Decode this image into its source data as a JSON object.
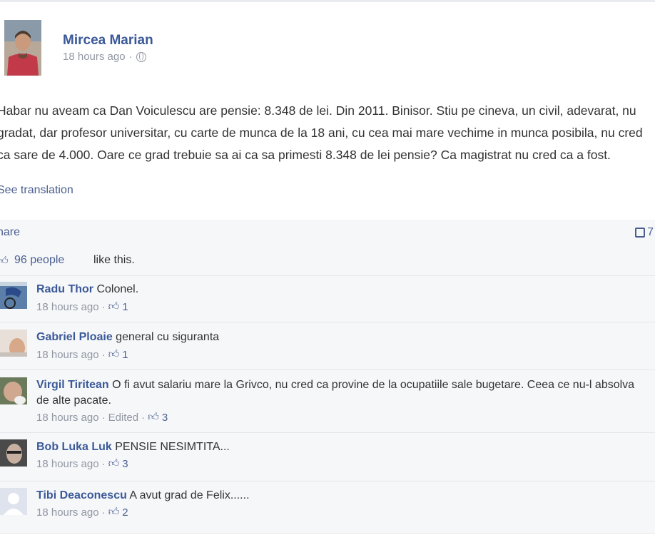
{
  "post": {
    "author": "Mircea Marian",
    "time": "18 hours ago",
    "text": "Habar nu aveam ca Dan Voiculescu are pensie: 8.348 de lei. Din 2011. Binisor. Stiu pe cineva, un civil, adevarat, nu gradat, dar profesor universitar, cu carte de munca de la 18 ani, cu cea mai mare vechime in munca posibila, nu cred ca sare de 4.000. Oare ce grad trebuie sa ai ca sa primesti 8.348 de lei pensie? Ca magistrat nu cred ca a fost.",
    "see_translation": "See translation"
  },
  "actions": {
    "share": "hare",
    "comment_count": "7"
  },
  "likes": {
    "count_link": "96 people",
    "rest": "like this."
  },
  "comments": [
    {
      "author": "Radu Thor",
      "text": "Colonel.",
      "time": "18 hours ago",
      "edited": "",
      "likes": "1"
    },
    {
      "author": "Gabriel Ploaie",
      "text": "general cu siguranta",
      "time": "18 hours ago",
      "edited": "",
      "likes": "1"
    },
    {
      "author": "Virgil Tiritean",
      "text": "O fi avut salariu mare la Grivco, nu cred ca provine de la ocupatiile sale bugetare. Ceea ce nu-l absolva de alte pacate.",
      "time": "18 hours ago",
      "edited": "Edited",
      "likes": "3"
    },
    {
      "author": "Bob Luka Luk",
      "text": "PENSIE NESIMTITA...",
      "time": "18 hours ago",
      "edited": "",
      "likes": "3"
    },
    {
      "author": "Tibi Deaconescu",
      "text": "A avut grad de Felix......",
      "time": "18 hours ago",
      "edited": "",
      "likes": "2"
    }
  ],
  "colors": {
    "link": "#3b5998",
    "meta": "#9197a3",
    "panel": "#f6f7f9"
  }
}
